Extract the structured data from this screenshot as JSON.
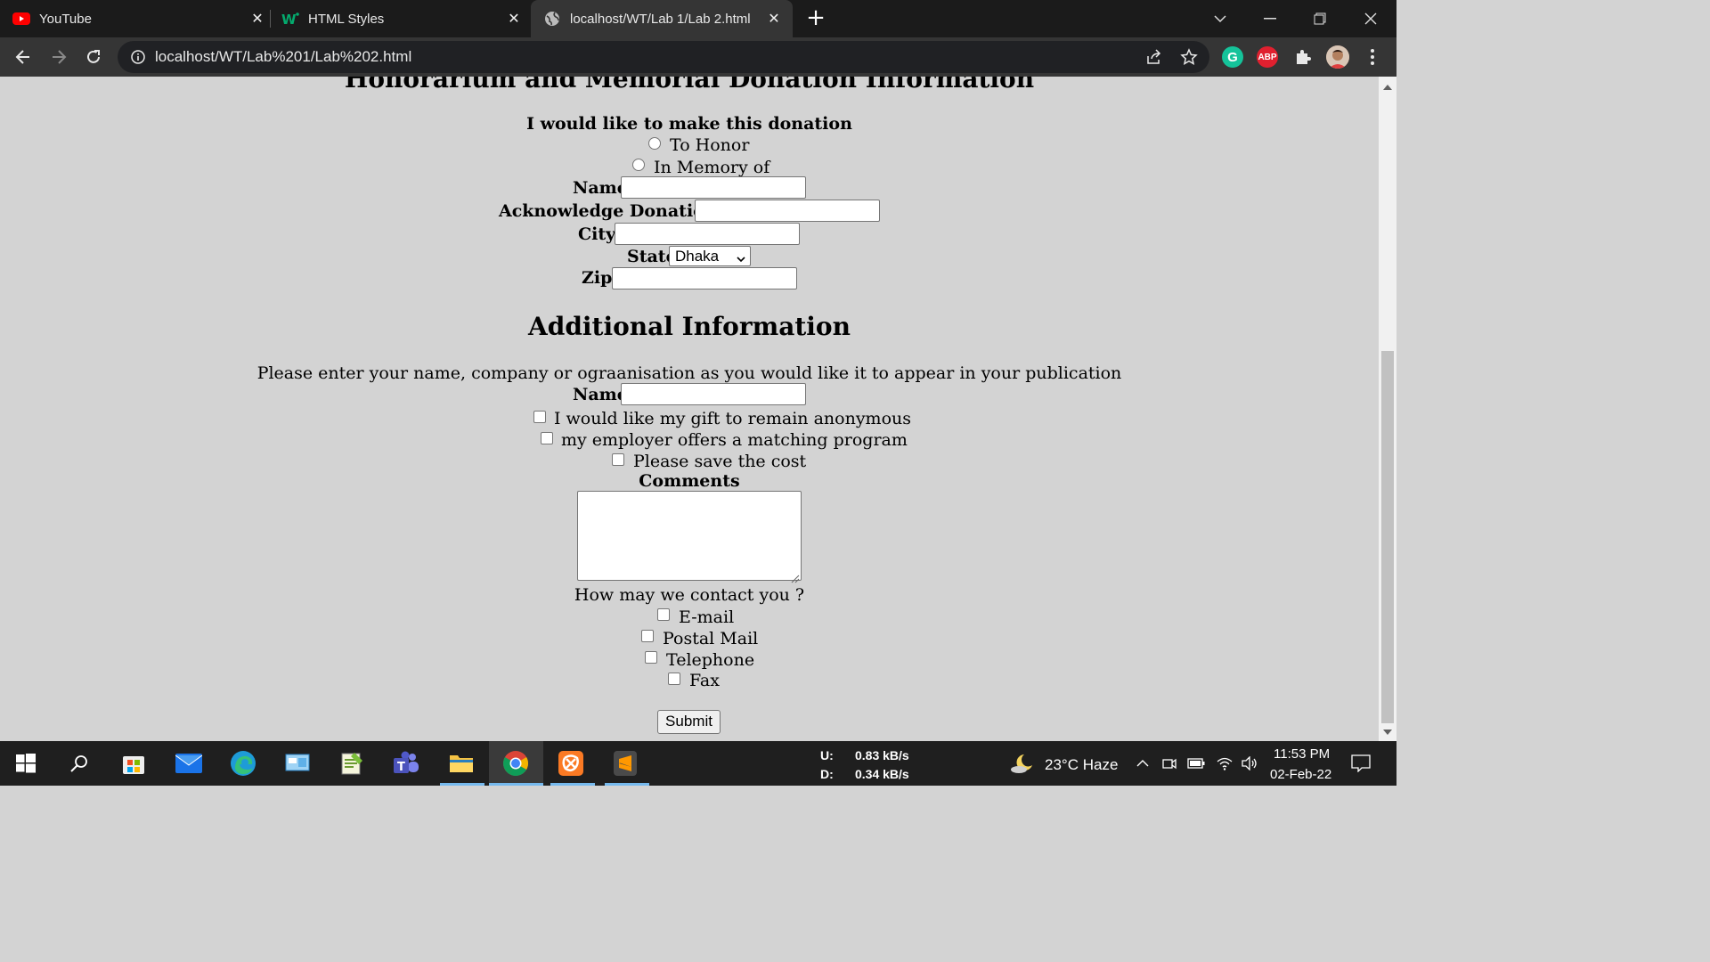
{
  "browser": {
    "tabs": [
      {
        "title": "YouTube",
        "favicon": "youtube-icon"
      },
      {
        "title": "HTML Styles",
        "favicon": "w3schools-icon"
      },
      {
        "title": "localhost/WT/Lab 1/Lab 2.html",
        "favicon": "globe-icon",
        "active": true
      }
    ],
    "address": "localhost/WT/Lab%201/Lab%202.html",
    "extensions": {
      "grammarly": "G",
      "adblock": "ABP"
    }
  },
  "page": {
    "cut_heading": "Honorarium and Memorial Donation Information",
    "donation_prompt": "I would like to make this donation",
    "radio_to_honor": "To Honor",
    "radio_in_memory": "In Memory of",
    "name_label": "Name",
    "acknowledge_label": "Acknowledge Donation to",
    "city_label": "City",
    "state_label": "State",
    "state_value": "Dhaka",
    "zip_label": "Zip",
    "additional_heading": "Additional Information",
    "publication_text": "Please enter your name, company or ograanisation as you would like it to appear in your publication",
    "name2_label": "Name",
    "check_anonymous": "I would like my gift to remain anonymous",
    "check_employer": "my employer offers a matching program",
    "check_save_cost": "Please save the cost",
    "comments_label": "Comments",
    "contact_prompt": "How may we contact you ?",
    "contact_email": "E-mail",
    "contact_postal": "Postal Mail",
    "contact_telephone": "Telephone",
    "contact_fax": "Fax",
    "submit_label": "Submit"
  },
  "taskbar": {
    "net_up_label": "U:",
    "net_up_value": "0.83 kB/s",
    "net_down_label": "D:",
    "net_down_value": "0.34 kB/s",
    "weather": "23°C  Haze",
    "time": "11:53 PM",
    "date": "02-Feb-22"
  },
  "colors": {
    "page_bg": "#d3d3d3",
    "chrome_dark": "#1b1b1b",
    "toolbar": "#353535"
  }
}
